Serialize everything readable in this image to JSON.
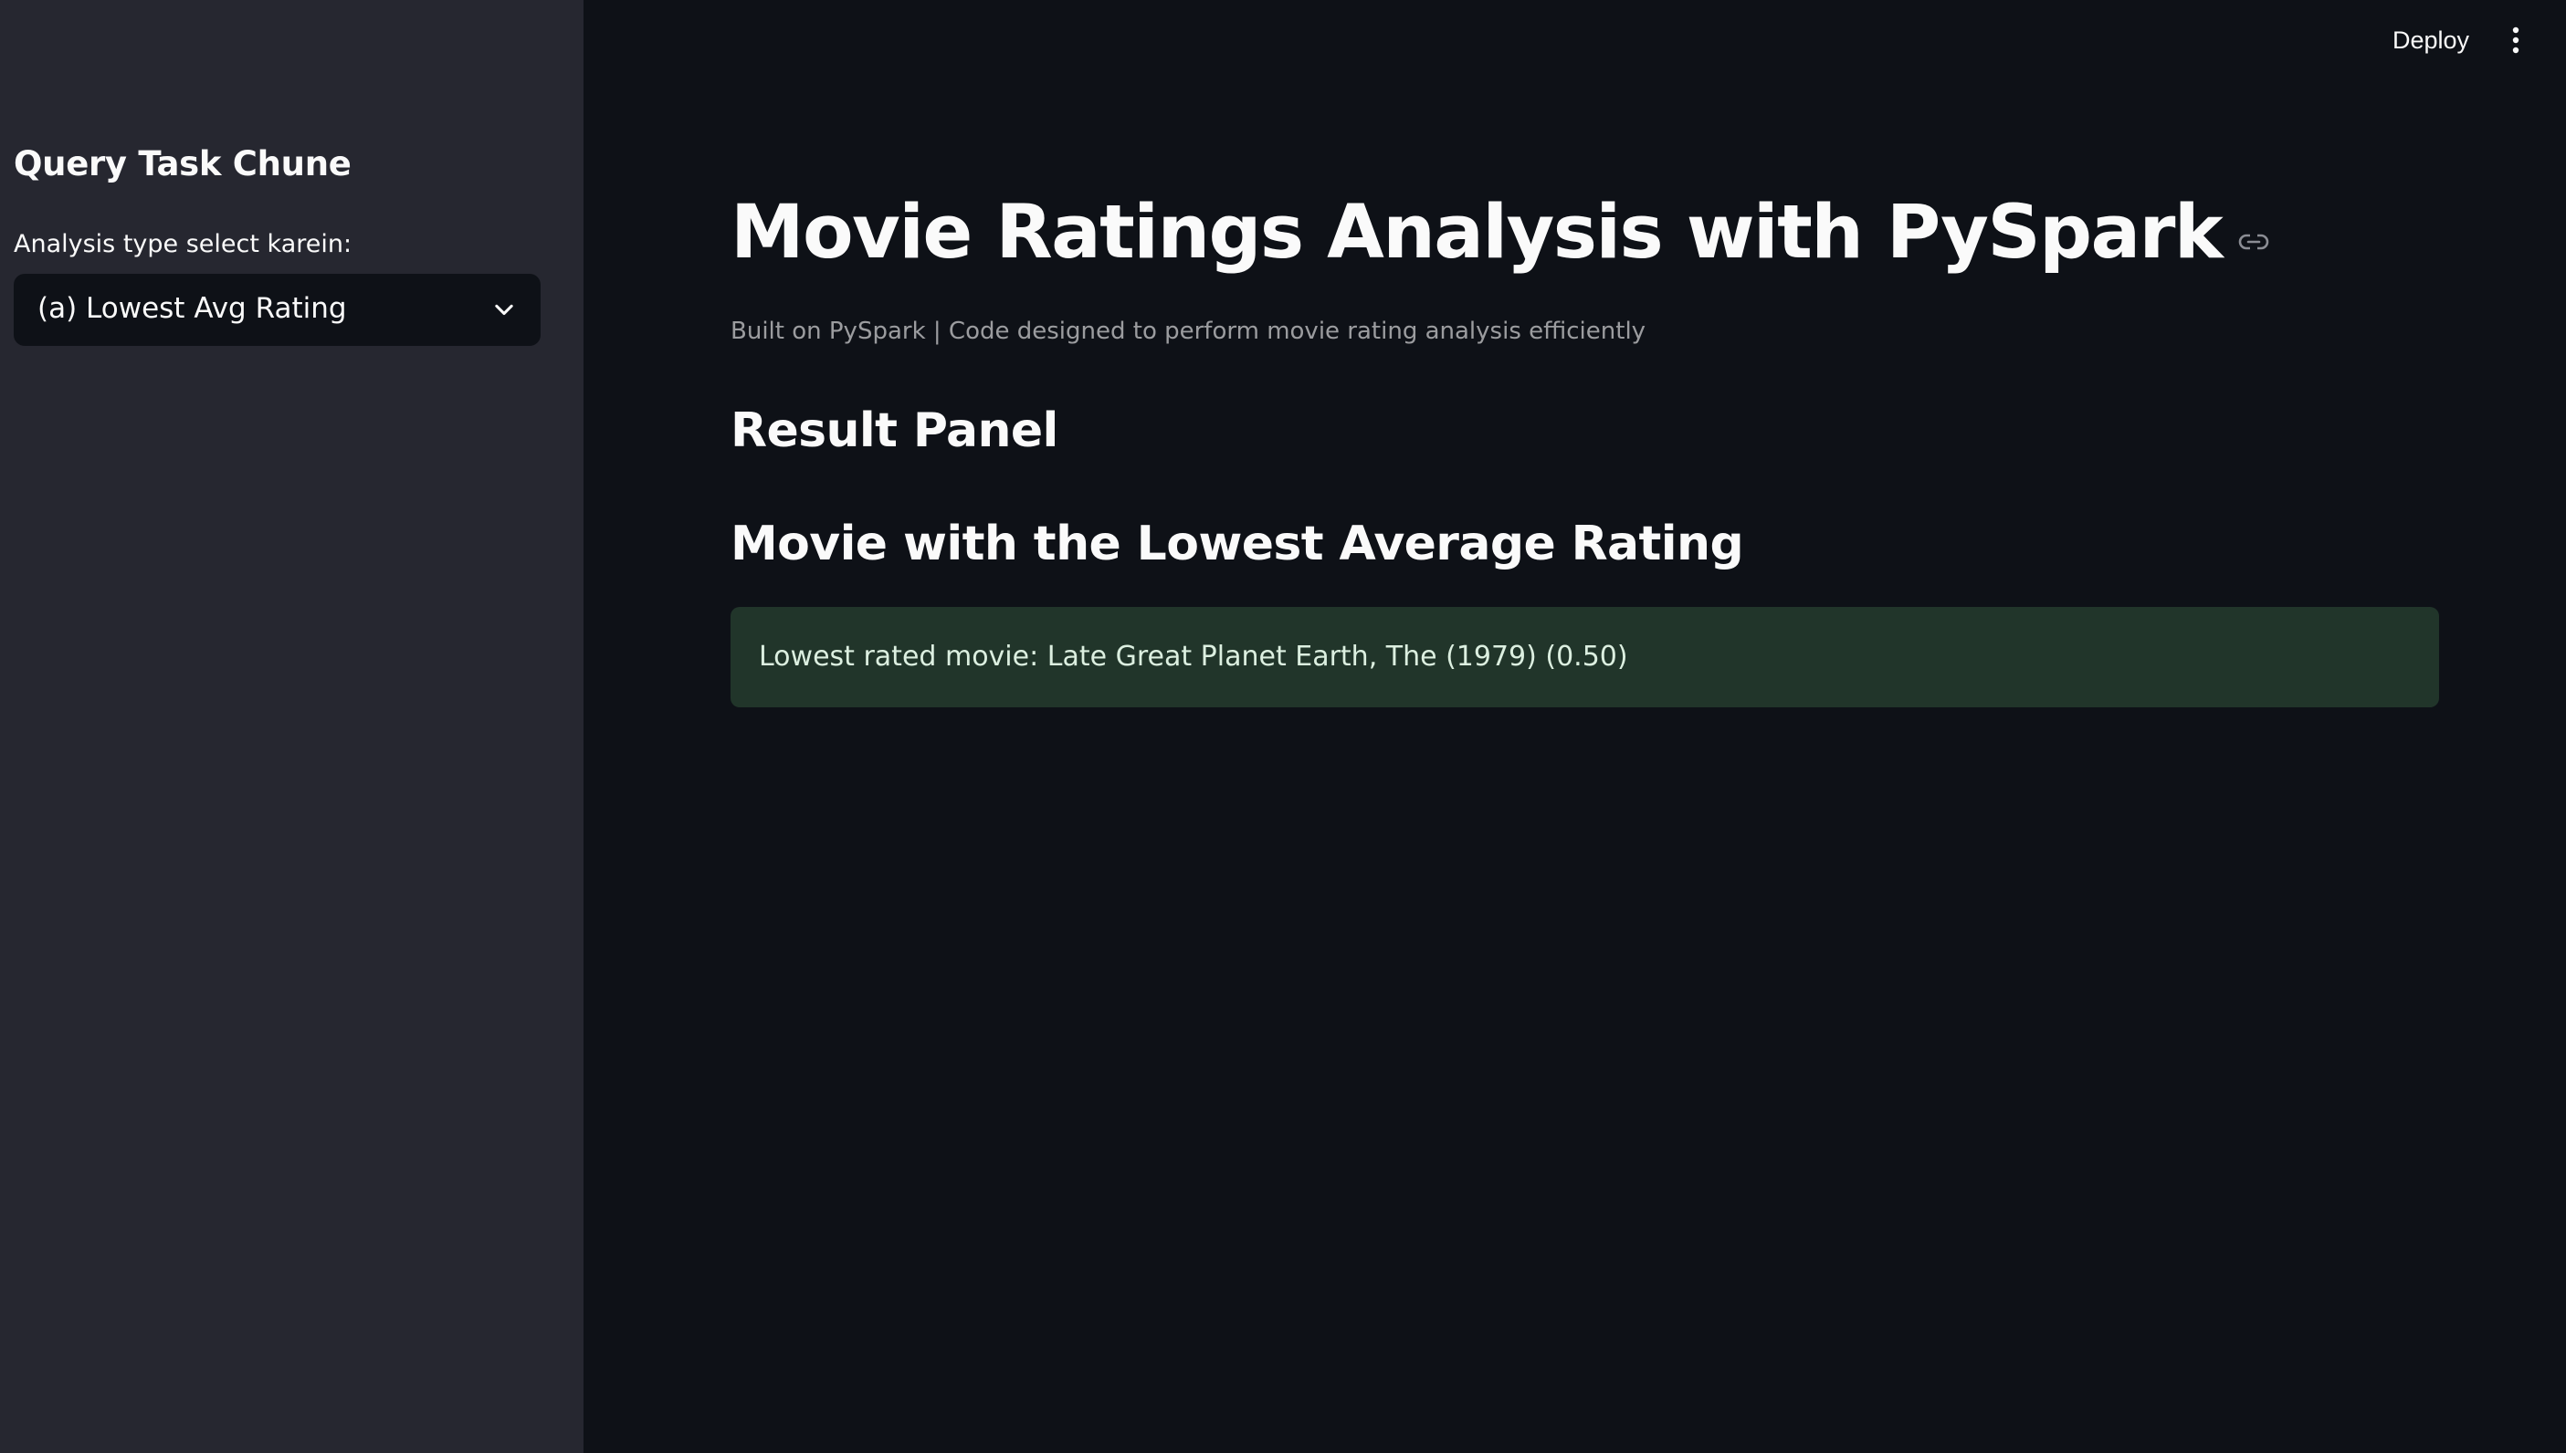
{
  "sidebar": {
    "header": "Query Task Chune",
    "select_label": "Analysis type select karein:",
    "select_value": "(a) Lowest Avg Rating"
  },
  "header": {
    "deploy_label": "Deploy"
  },
  "main": {
    "title": "Movie Ratings Analysis with PySpark",
    "caption": "Built on PySpark | Code designed to perform movie rating analysis efficiently",
    "result_header": "Result Panel",
    "subheader": "Movie with the Lowest Average Rating",
    "success_message": "Lowest rated movie: Late Great Planet Earth, The (1979) (0.50)"
  },
  "icons": {
    "select_chevron": "chevron-down-icon",
    "menu": "more-vertical-icon",
    "anchor": "link-icon"
  },
  "colors": {
    "app_background": "#0e1117",
    "sidebar_background": "#262730",
    "success_background": "#21352a",
    "text": "#fafafa"
  }
}
